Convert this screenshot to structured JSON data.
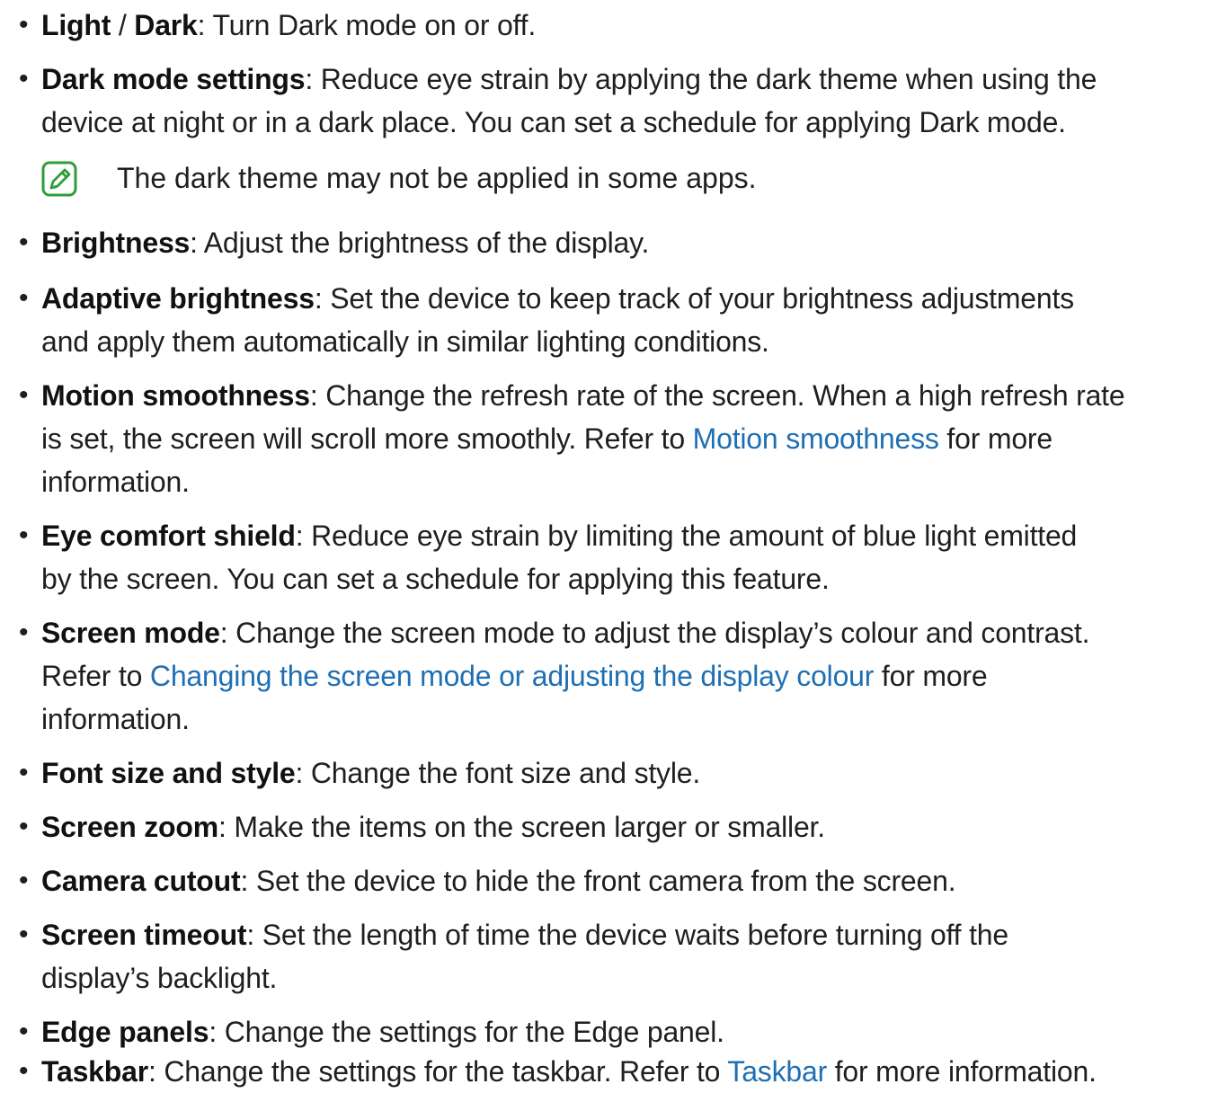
{
  "items": [
    {
      "term": "Light",
      "sep": " / ",
      "term2": "Dark",
      "lines": [
        ": Turn Dark mode on or off."
      ]
    },
    {
      "term": "Dark mode settings",
      "lines": [
        ": Reduce eye strain by applying the dark theme when using the",
        "device at night or in a dark place. You can set a schedule for applying Dark mode."
      ],
      "note": "The dark theme may not be applied in some apps."
    },
    {
      "term": "Brightness",
      "lines": [
        ": Adjust the brightness of the display."
      ]
    },
    {
      "term": "Adaptive brightness",
      "lines": [
        ": Set the device to keep track of your brightness adjustments",
        "and apply them automatically in similar lighting conditions."
      ]
    },
    {
      "term": "Motion smoothness",
      "lines": [
        ": Change the refresh rate of the screen. When a high refresh rate",
        "is set, the screen will scroll more smoothly. Refer to ",
        "information."
      ],
      "link": "Motion smoothness",
      "after_link": " for more"
    },
    {
      "term": "Eye comfort shield",
      "lines": [
        ": Reduce eye strain by limiting the amount of blue light emitted",
        "by the screen. You can set a schedule for applying this feature."
      ]
    },
    {
      "term": "Screen mode",
      "lines": [
        ": Change the screen mode to adjust the display’s colour and contrast.",
        "Refer to ",
        "information."
      ],
      "link": "Changing the screen mode or adjusting the display colour",
      "after_link": " for more"
    },
    {
      "term": "Font size and style",
      "lines": [
        ": Change the font size and style."
      ]
    },
    {
      "term": "Screen zoom",
      "lines": [
        ": Make the items on the screen larger or smaller."
      ]
    },
    {
      "term": "Camera cutout",
      "lines": [
        ": Set the device to hide the front camera from the screen."
      ]
    },
    {
      "term": "Screen timeout",
      "lines": [
        ": Set the length of time the device waits before turning off the",
        "display’s backlight."
      ]
    },
    {
      "term": "Edge panels",
      "lines": [
        ": Change the settings for the Edge panel."
      ]
    },
    {
      "term": "Taskbar",
      "lines": [
        ": Change the settings for the taskbar. Refer to "
      ],
      "link": "Taskbar",
      "after_link": " for more information."
    }
  ],
  "colors": {
    "link": "#1f6fb3",
    "note_icon": "#2e9e3a"
  },
  "icons": {
    "note": "note-pencil-icon"
  }
}
